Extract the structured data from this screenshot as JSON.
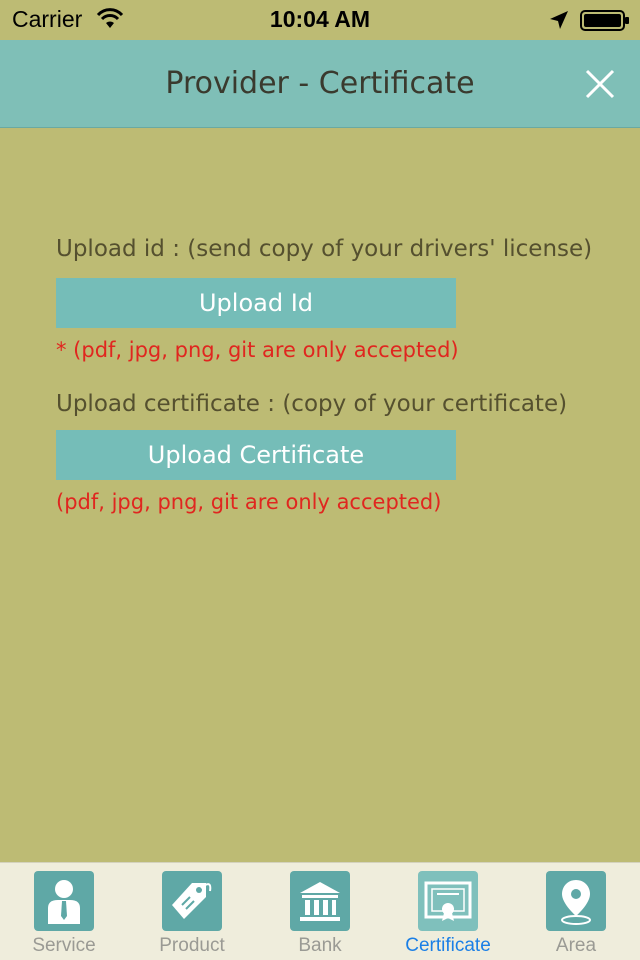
{
  "status_bar": {
    "carrier": "Carrier",
    "time": "10:04 AM"
  },
  "nav": {
    "title": "Provider - Certificate"
  },
  "form": {
    "id_label": "Upload id : (send copy of your drivers' license)",
    "id_button": "Upload Id",
    "id_note": "* (pdf, jpg, png, git are only accepted)",
    "cert_label": "Upload certificate : (copy of your certificate)",
    "cert_button": "Upload Certificate",
    "cert_note": "(pdf, jpg, png, git are only accepted)"
  },
  "tabs": [
    {
      "label": "Service",
      "icon": "person-icon",
      "active": false
    },
    {
      "label": "Product",
      "icon": "tag-icon",
      "active": false
    },
    {
      "label": "Bank",
      "icon": "bank-icon",
      "active": false
    },
    {
      "label": "Certificate",
      "icon": "certificate-icon",
      "active": true
    },
    {
      "label": "Area",
      "icon": "location-pin-icon",
      "active": false
    }
  ],
  "colors": {
    "background": "#bdbb74",
    "nav_bar": "#7fbfb7",
    "button": "#75bdb8",
    "note_text": "#e0261f",
    "active_tab": "#1b7fe6"
  }
}
